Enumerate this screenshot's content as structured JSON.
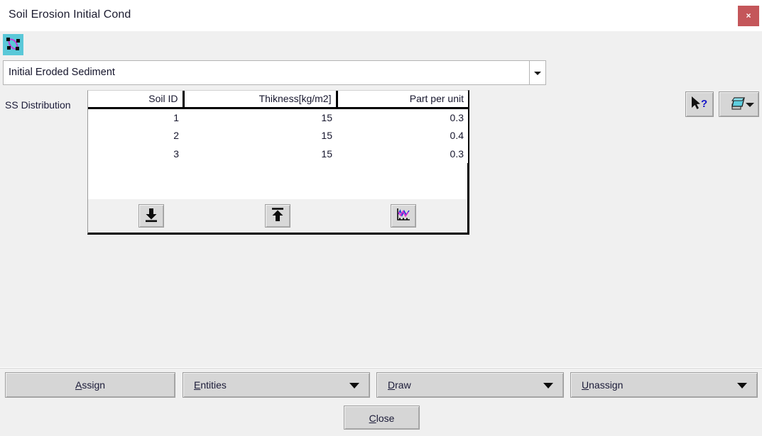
{
  "window": {
    "title": "Soil Erosion Initial Cond",
    "close_label": "×",
    "close_icon": "close-icon",
    "titlebar_bg": "#ffffff",
    "close_bg": "#c4565a",
    "body_bg": "#f0f0f0"
  },
  "toolbar": {
    "shape_icon": "shape-nodes-icon",
    "shape_icon_bg": "#5ac8d8",
    "shape_icon_stroke": "#c23fd8"
  },
  "combo": {
    "value": "Initial Eroded Sediment",
    "arrow_icon": "chevron-down-icon"
  },
  "top_buttons": [
    {
      "name": "help-cursor-button",
      "icon": "help-pointer-icon"
    },
    {
      "name": "layers-button",
      "icon": "layers-icon",
      "arrow_icon": "chevron-down-icon"
    }
  ],
  "section": {
    "label": "SS Distribution"
  },
  "table": {
    "columns": [
      "Soil ID",
      "Thikness[kg/m2]",
      "Part per unit"
    ],
    "rows": [
      [
        "1",
        "15",
        "0.3"
      ],
      [
        "2",
        "15",
        "0.4"
      ],
      [
        "3",
        "15",
        "0.3"
      ]
    ],
    "buttons": [
      {
        "name": "import-button",
        "icon": "import-down-arrow-icon"
      },
      {
        "name": "export-button",
        "icon": "export-up-arrow-icon"
      },
      {
        "name": "plot-button",
        "icon": "plot-chart-icon"
      }
    ]
  },
  "actions": {
    "assign": {
      "accel": "A",
      "rest": "ssign",
      "full": "Assign"
    },
    "entities": {
      "accel": "E",
      "rest": "ntities",
      "full": "Entities"
    },
    "draw": {
      "accel": "D",
      "rest": "raw",
      "full": "Draw"
    },
    "unassign": {
      "accel": "U",
      "rest": "nassign",
      "full": "Unassign"
    },
    "close": {
      "accel": "C",
      "rest": "lose",
      "full": "Close"
    }
  }
}
